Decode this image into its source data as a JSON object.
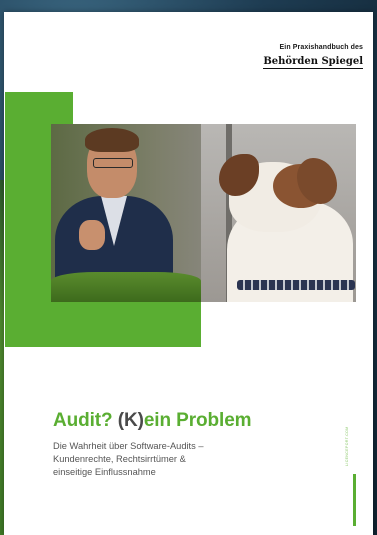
{
  "publisher": {
    "kicker": "Ein Praxishandbuch des",
    "name": "Behörden Spiegel"
  },
  "cover": {
    "title_part1": "Audit? ",
    "title_part2": "(K)",
    "title_part3": "ein Problem",
    "subtitle_line1": "Die Wahrheit über Software-Audits –",
    "subtitle_line2": "Kundenrechte, Rechtsirrtümer &",
    "subtitle_line3": "einseitige Einflussnahme",
    "side_url": "LICENCEPORT.COM"
  },
  "colors": {
    "accent_green": "#5aae32",
    "title_dark": "#4a4a4a",
    "text_gray": "#555555"
  }
}
